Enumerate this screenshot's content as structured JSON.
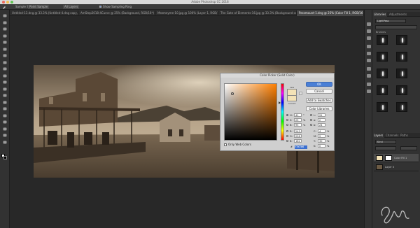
{
  "app": {
    "title": "Adobe Photoshop CC 2018",
    "traffic_colors": [
      "#ed6a5e",
      "#f4bf4f",
      "#61c554"
    ]
  },
  "options_bar": {
    "sample_size_label": "Sample Size:",
    "sample_size_value": "Point Sample",
    "sample_value": "All Layers",
    "show_ring_label": "Show Sampling Ring"
  },
  "doc_tabs": [
    {
      "label": "Untitled-13.dng @ 33.3% (Untitled-4.dng copy, Layer Mask/8) *",
      "active": false
    },
    {
      "label": "AmStep2018-4Curve @ 25% (Background, RGB/16*)",
      "active": false
    },
    {
      "label": "Mezmeyme-10.jpg @ 100% (Layer 1, RGB/16*)",
      "active": false
    },
    {
      "label": "The Gate of Elements-16.jpg @ 33.3% (Background copy,",
      "active": false
    },
    {
      "label": "Paramount-1.dng @ 25% (Color Fill 1, RGB/16*) *",
      "active": true
    }
  ],
  "dialog": {
    "title": "Color Picker (Solid Color)",
    "new_label": "new",
    "current_label": "current",
    "buttons": {
      "ok": "OK",
      "cancel": "Cancel",
      "add_swatches": "Add to Swatches",
      "color_libraries": "Color Libraries"
    },
    "hsb": [
      {
        "label": "H:",
        "value": "41",
        "unit": "°"
      },
      {
        "label": "S:",
        "value": "25",
        "unit": "%"
      },
      {
        "label": "B:",
        "value": "95",
        "unit": "%"
      }
    ],
    "rgb": [
      {
        "label": "R:",
        "value": "243"
      },
      {
        "label": "G:",
        "value": "226"
      },
      {
        "label": "B:",
        "value": "182"
      }
    ],
    "lab": [
      {
        "label": "L:",
        "value": "91"
      },
      {
        "label": "a:",
        "value": "2"
      },
      {
        "label": "b:",
        "value": "24"
      }
    ],
    "cmyk": [
      {
        "label": "C:",
        "value": "4",
        "unit": "%"
      },
      {
        "label": "M:",
        "value": "9",
        "unit": "%"
      },
      {
        "label": "Y:",
        "value": "30",
        "unit": "%"
      },
      {
        "label": "K:",
        "value": "0",
        "unit": "%"
      }
    ],
    "web_only_label": "Only Web Colors",
    "hex_label": "#",
    "hex_value": "f3e2b6",
    "picked_color": "#f3e2b6"
  },
  "libraries_panel": {
    "tabs": [
      "Libraries",
      "Adjustments"
    ],
    "library_name": "LightPass",
    "section_label": "Brushes"
  },
  "layers_panel": {
    "tabs": [
      "Layers",
      "Channels",
      "Paths"
    ],
    "kind_label": "Kind",
    "layers": [
      {
        "name": "Color Fill 1",
        "thumb_color": "#f3e2b6"
      },
      {
        "name": "Layer 0",
        "thumb_color": "#6b5a44"
      }
    ]
  }
}
